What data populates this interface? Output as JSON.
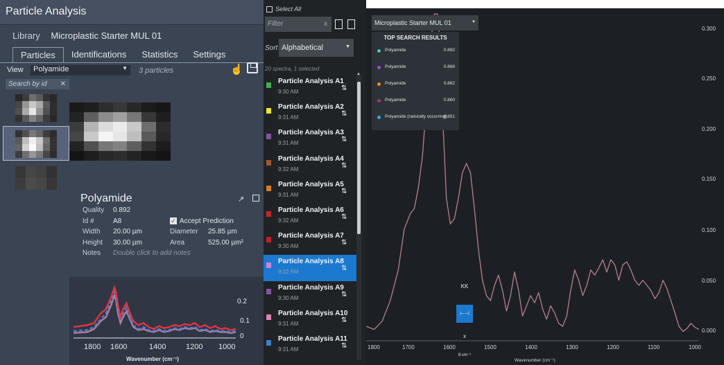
{
  "left_panel": {
    "title": "Particle Analysis",
    "library_label": "Library",
    "library_value": "Microplastic Starter MUL 01",
    "tabs": [
      "Particles",
      "Identifications",
      "Statistics",
      "Settings"
    ],
    "view_label": "View",
    "view_value": "Polyamide",
    "particle_count": "3 particles",
    "search_placeholder": "Search by id",
    "search_clear": "✕",
    "particle": {
      "name": "Polyamide",
      "quality_label": "Quality",
      "quality_value": "0.892",
      "id_label": "Id #",
      "id_value": "A8",
      "accept_label": "Accept Prediction",
      "width_label": "Width",
      "width_value": "20.00 µm",
      "diameter_label": "Diameter",
      "diameter_value": "25.85 µm",
      "height_label": "Height",
      "height_value": "30.00 µm",
      "area_label": "Area",
      "area_value": "525.00 µm²",
      "notes_label": "Notes",
      "notes_placeholder": "Double click to add notes"
    },
    "mini_chart": {
      "x_ticks": [
        "1800",
        "1600",
        "1400",
        "1200",
        "1000"
      ],
      "y_ticks": [
        "0.2",
        "0.1",
        "0"
      ],
      "xlabel": "Wavenumber (cm⁻¹)"
    }
  },
  "middle_list": {
    "select_all": "Select All",
    "filter_placeholder": "Filter",
    "filter_clear": "x",
    "sort_label": "Sort",
    "sort_value": "Alphabetical",
    "summary": "20 spectra, 1 selected",
    "items": [
      {
        "name": "Particle Analysis A1",
        "time": "9:30 AM",
        "color": "#3cb44b"
      },
      {
        "name": "Particle Analysis A2",
        "time": "9:31 AM",
        "color": "#f7e51d"
      },
      {
        "name": "Particle Analysis A3",
        "time": "9:31 AM",
        "color": "#8c4fa6"
      },
      {
        "name": "Particle Analysis A4",
        "time": "9:32 AM",
        "color": "#a9542c"
      },
      {
        "name": "Particle Analysis A5",
        "time": "9:31 AM",
        "color": "#e07a1f"
      },
      {
        "name": "Particle Analysis A6",
        "time": "9:32 AM",
        "color": "#d02027"
      },
      {
        "name": "Particle Analysis A7",
        "time": "9:30 AM",
        "color": "#c81d25"
      },
      {
        "name": "Particle Analysis A8",
        "time": "9:32 AM",
        "color": "#d77fd3"
      },
      {
        "name": "Particle Analysis A9",
        "time": "9:30 AM",
        "color": "#8c4fa6"
      },
      {
        "name": "Particle Analysis A10",
        "time": "9:31 AM",
        "color": "#e37fb4"
      },
      {
        "name": "Particle Analysis A11",
        "time": "9:31 AM",
        "color": "#3c7fd6"
      }
    ],
    "selected_index": 7
  },
  "right_panel": {
    "library_select": "Microplastic Starter MUL 01",
    "results_title": "TOP SEARCH RESULTS",
    "results": [
      {
        "name": "Polyamide",
        "score": "0.892",
        "color": "#3fc7bd"
      },
      {
        "name": "Polyamide",
        "score": "0.868",
        "color": "#9a4fd1"
      },
      {
        "name": "Polyamide",
        "score": "0.862",
        "color": "#f08a22"
      },
      {
        "name": "Polyamide",
        "score": "0.860",
        "color": "#a5347c"
      },
      {
        "name": "Polyamide (naturally occurring)",
        "score": "0.851",
        "color": "#3da6e6"
      }
    ],
    "tools": {
      "kk": "KK",
      "x": "x",
      "res": "8 cm⁻¹"
    },
    "window_controls": "– ▢"
  },
  "chart_data": {
    "type": "line",
    "xlabel": "Wavenumber (cm⁻¹)",
    "ylabel": "",
    "x_ticks": [
      "1800",
      "1700",
      "1600",
      "1500",
      "1400",
      "1300",
      "1200",
      "1100",
      "1000"
    ],
    "y_ticks": [
      "0.300",
      "0.250",
      "0.200",
      "0.150",
      "0.100",
      "0.050",
      "0.000"
    ],
    "xlim": [
      1810,
      980
    ],
    "ylim": [
      -0.005,
      0.31
    ],
    "line_color": "#b7808f",
    "series": [
      {
        "x": [
          1810,
          1790,
          1770,
          1750,
          1730,
          1715,
          1700,
          1690,
          1680,
          1670,
          1660,
          1650,
          1640,
          1632,
          1625,
          1618,
          1610,
          1600,
          1590,
          1580,
          1570,
          1560,
          1550,
          1540,
          1530,
          1520,
          1510,
          1500,
          1490,
          1480,
          1470,
          1460,
          1450,
          1440,
          1430,
          1420,
          1410,
          1400,
          1390,
          1380,
          1370,
          1360,
          1350,
          1340,
          1330,
          1320,
          1310,
          1300,
          1290,
          1280,
          1270,
          1260,
          1250,
          1240,
          1230,
          1220,
          1210,
          1200,
          1190,
          1180,
          1170,
          1160,
          1150,
          1140,
          1130,
          1120,
          1110,
          1100,
          1090,
          1080,
          1070,
          1060,
          1050,
          1040,
          1030,
          1020,
          1010,
          1000,
          990,
          980
        ],
        "y": [
          0.005,
          0.002,
          0.01,
          0.03,
          0.06,
          0.1,
          0.115,
          0.12,
          0.14,
          0.17,
          0.22,
          0.28,
          0.31,
          0.31,
          0.28,
          0.2,
          0.13,
          0.105,
          0.11,
          0.13,
          0.155,
          0.164,
          0.155,
          0.12,
          0.08,
          0.05,
          0.035,
          0.03,
          0.045,
          0.055,
          0.04,
          0.02,
          0.035,
          0.058,
          0.04,
          0.015,
          0.025,
          0.035,
          0.028,
          0.038,
          0.022,
          0.012,
          0.025,
          0.018,
          0.008,
          0.005,
          0.015,
          0.04,
          0.06,
          0.05,
          0.035,
          0.045,
          0.06,
          0.055,
          0.062,
          0.07,
          0.058,
          0.07,
          0.065,
          0.05,
          0.065,
          0.068,
          0.06,
          0.05,
          0.045,
          0.05,
          0.045,
          0.04,
          0.032,
          0.038,
          0.05,
          0.042,
          0.03,
          0.018,
          0.005,
          0.0,
          0.003,
          0.008,
          0.004,
          0.002
        ]
      }
    ]
  },
  "mini_chart_data": {
    "type": "line",
    "xlim": [
      1880,
      930
    ],
    "ylim": [
      -0.005,
      0.26
    ],
    "series": [
      {
        "name": "",
        "color": "#e8343e",
        "dash": false,
        "x": [
          1880,
          1800,
          1760,
          1720,
          1690,
          1660,
          1640,
          1630,
          1620,
          1605,
          1590,
          1570,
          1550,
          1530,
          1500,
          1470,
          1440,
          1410,
          1380,
          1350,
          1320,
          1290,
          1260,
          1230,
          1200,
          1170,
          1140,
          1110,
          1080,
          1050,
          1020,
          990,
          960,
          930
        ],
        "y": [
          0.05,
          0.06,
          0.07,
          0.12,
          0.14,
          0.2,
          0.25,
          0.22,
          0.16,
          0.1,
          0.14,
          0.17,
          0.12,
          0.08,
          0.06,
          0.07,
          0.05,
          0.04,
          0.055,
          0.045,
          0.05,
          0.06,
          0.055,
          0.065,
          0.06,
          0.07,
          0.05,
          0.06,
          0.045,
          0.055,
          0.04,
          0.045,
          0.035,
          0.04
        ]
      },
      {
        "name": "",
        "color": "#4a7fd8",
        "dash": true,
        "x": [
          1880,
          1800,
          1760,
          1720,
          1690,
          1660,
          1640,
          1630,
          1620,
          1605,
          1590,
          1570,
          1550,
          1530,
          1500,
          1470,
          1440,
          1410,
          1380,
          1350,
          1320,
          1290,
          1260,
          1230,
          1200,
          1170,
          1140,
          1110,
          1080,
          1050,
          1020,
          990,
          960,
          930
        ],
        "y": [
          0.03,
          0.035,
          0.05,
          0.09,
          0.12,
          0.18,
          0.23,
          0.2,
          0.14,
          0.08,
          0.12,
          0.15,
          0.1,
          0.06,
          0.04,
          0.05,
          0.035,
          0.03,
          0.04,
          0.03,
          0.035,
          0.045,
          0.04,
          0.05,
          0.045,
          0.05,
          0.035,
          0.04,
          0.03,
          0.035,
          0.03,
          0.03,
          0.025,
          0.03
        ]
      },
      {
        "name": "",
        "color": "#b07fa0",
        "dash": false,
        "x": [
          1880,
          1800,
          1760,
          1720,
          1690,
          1660,
          1640,
          1630,
          1620,
          1605,
          1590,
          1570,
          1550,
          1530,
          1500,
          1470,
          1440,
          1410,
          1380,
          1350,
          1320,
          1290,
          1260,
          1230,
          1200,
          1170,
          1140,
          1110,
          1080,
          1050,
          1020,
          990,
          960,
          930
        ],
        "y": [
          0.02,
          0.025,
          0.04,
          0.08,
          0.1,
          0.16,
          0.21,
          0.18,
          0.12,
          0.07,
          0.1,
          0.13,
          0.09,
          0.05,
          0.035,
          0.04,
          0.03,
          0.025,
          0.035,
          0.025,
          0.03,
          0.04,
          0.035,
          0.045,
          0.04,
          0.045,
          0.03,
          0.035,
          0.025,
          0.03,
          0.025,
          0.025,
          0.02,
          0.025
        ]
      }
    ]
  }
}
